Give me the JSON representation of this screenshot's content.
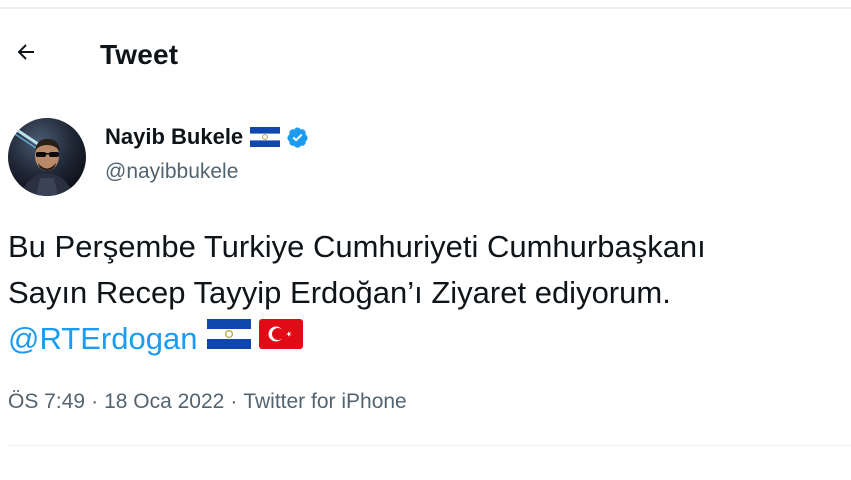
{
  "header": {
    "back_icon": "arrow-left-icon",
    "title": "Tweet"
  },
  "author": {
    "display_name": "Nayib Bukele",
    "name_flag_icon": "el-salvador-flag-icon",
    "verified_icon": "verified-badge-icon",
    "handle": "@nayibbukele"
  },
  "tweet": {
    "line1": "Bu Perşembe Turkiye Cumhuriyeti Cumhurbaşkanı",
    "line2": "Sayın Recep Tayyip Erdoğan’ı Ziyaret ediyorum.",
    "mention": "@RTErdogan",
    "flags": [
      "el-salvador-flag-icon",
      "turkey-flag-icon"
    ]
  },
  "meta": {
    "time": "ÖS 7:49",
    "separator": "·",
    "date": "18 Oca 2022",
    "source": "Twitter for iPhone"
  },
  "colors": {
    "accent": "#1d9bf0",
    "text": "#0f1419",
    "secondary": "#536471",
    "turkey_red": "#e30a17",
    "salvador_blue": "#0f47af"
  }
}
